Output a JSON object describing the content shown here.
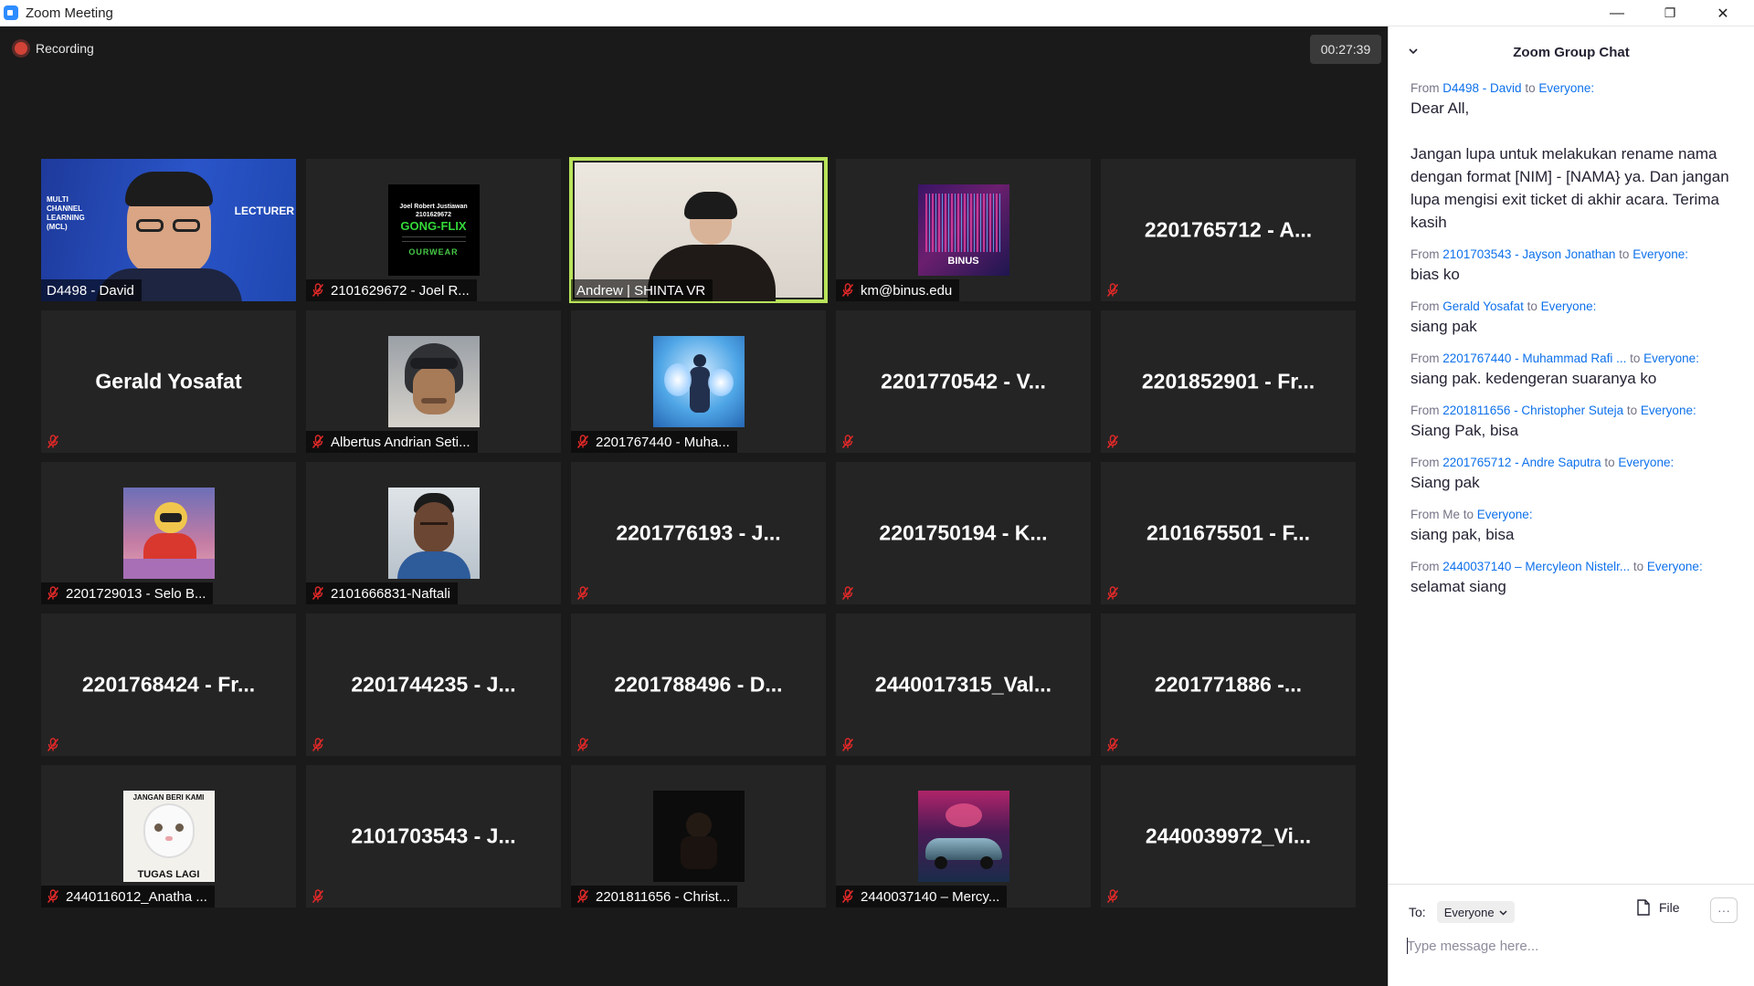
{
  "window": {
    "title": "Zoom Meeting",
    "minimize": "—",
    "restore": "❐",
    "close": "✕"
  },
  "meeting": {
    "recording_label": "Recording",
    "timer": "00:27:39"
  },
  "tiles": [
    {
      "label": "D4498 - David",
      "type": "video-david",
      "muted": false
    },
    {
      "label": "2101629672 - Joel R...",
      "type": "avatar-joel",
      "muted": true
    },
    {
      "label": "Andrew | SHINTA VR",
      "type": "video-andrew",
      "muted": false,
      "speaking": true
    },
    {
      "label": "km@binus.edu",
      "type": "avatar-binus",
      "muted": true
    },
    {
      "big": "2201765712 - A...",
      "muted": true
    },
    {
      "big": "Gerald Yosafat",
      "muted": true
    },
    {
      "label": "Albertus Andrian Seti...",
      "type": "avatar-helmet",
      "muted": true
    },
    {
      "label": "2201767440 - Muha...",
      "type": "avatar-figure",
      "muted": true
    },
    {
      "big": "2201770542 - V...",
      "muted": true
    },
    {
      "big": "2201852901 - Fr...",
      "muted": true
    },
    {
      "label": "2201729013 - Selo B...",
      "type": "avatar-anime",
      "muted": true
    },
    {
      "label": "2101666831-Naftali",
      "type": "avatar-face",
      "muted": true
    },
    {
      "big": "2201776193 - J...",
      "muted": true
    },
    {
      "big": "2201750194 - K...",
      "muted": true
    },
    {
      "big": "2101675501 - F...",
      "muted": true
    },
    {
      "big": "2201768424 - Fr...",
      "muted": true
    },
    {
      "big": "2201744235 - J...",
      "muted": true
    },
    {
      "big": "2201788496 - D...",
      "muted": true
    },
    {
      "big": "2440017315_Val...",
      "muted": true
    },
    {
      "big": "2201771886 -...",
      "muted": true
    },
    {
      "label": "2440116012_Anatha ...",
      "type": "avatar-cat",
      "muted": true
    },
    {
      "big": "2101703543 - J...",
      "muted": true
    },
    {
      "label": "2201811656 - Christ...",
      "type": "avatar-dark",
      "muted": true
    },
    {
      "label": "2440037140 – Mercy...",
      "type": "avatar-car",
      "muted": true
    },
    {
      "big": "2440039972_Vi...",
      "muted": true
    }
  ],
  "avatar_text": {
    "david_banner_1": "MULTI",
    "david_banner_2": "CHANNEL",
    "david_banner_3": "LEARNING",
    "david_banner_4": "(MCL)",
    "david_lecturer": "LECTURER",
    "joel_name": "Joel Robert Justiawan",
    "joel_nim": "2101629672",
    "joel_brand": "GONG-FLIX",
    "joel_foot": "OURWEAR",
    "binus_logo": "BINUS",
    "cat_top": "JANGAN BERI KAMI",
    "cat_bottom": "TUGAS LAGI"
  },
  "chat": {
    "title": "Zoom Group Chat",
    "messages": [
      {
        "from": "From",
        "sender": "D4498 - David",
        "to": "to",
        "recipient": "Everyone:",
        "body": "Dear All,\n\nJangan lupa untuk melakukan rename nama dengan format [NIM] - [NAMA} ya. Dan jangan lupa mengisi exit ticket di akhir acara. Terima kasih"
      },
      {
        "from": "From",
        "sender": "2101703543 - Jayson Jonathan",
        "to": "to",
        "recipient": "Everyone:",
        "body": "bias ko"
      },
      {
        "from": "From",
        "sender": "Gerald Yosafat",
        "to": "to",
        "recipient": "Everyone:",
        "body": "siang pak"
      },
      {
        "from": "From",
        "sender": "2201767440 - Muhammad Rafi ...",
        "to": "to",
        "recipient": "Everyone:",
        "body": "siang pak. kedengeran suaranya ko"
      },
      {
        "from": "From",
        "sender": "2201811656 - Christopher Suteja",
        "to": "to",
        "recipient": "Everyone:",
        "body": "Siang Pak, bisa"
      },
      {
        "from": "From",
        "sender": "2201765712 - Andre Saputra",
        "to": "to",
        "recipient": "Everyone:",
        "body": "Siang pak"
      },
      {
        "from": "From Me",
        "sender": "",
        "to": "to",
        "recipient": "Everyone:",
        "body": "siang pak, bisa"
      },
      {
        "from": "From",
        "sender": "2440037140 – Mercyleon Nistelr...",
        "to": "to",
        "recipient": "Everyone:",
        "body": "selamat siang"
      }
    ],
    "to_label": "To:",
    "recipient_select": "Everyone",
    "file_label": "File",
    "more_label": "···",
    "input_placeholder": "Type message here..."
  },
  "colors": {
    "speaking": "#b9e35a",
    "link": "#0e71eb",
    "mute": "#e02828",
    "recording": "#d14336"
  }
}
